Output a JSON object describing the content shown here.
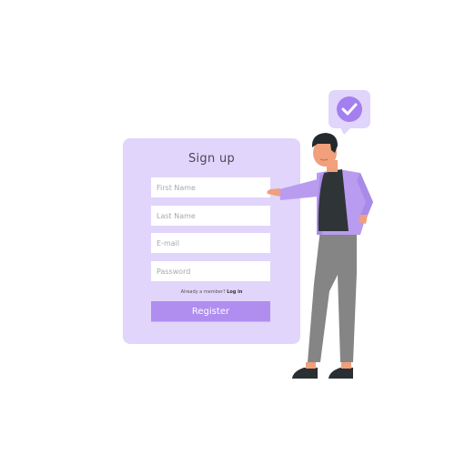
{
  "signup": {
    "title": "Sign up",
    "fields": {
      "first_name_placeholder": "First Name",
      "last_name_placeholder": "Last Name",
      "email_placeholder": "E-mail",
      "password_placeholder": "Password"
    },
    "login_prompt": "Already a member?",
    "login_link": "Log in",
    "register_label": "Register"
  },
  "illustration": {
    "badge_icon": "check-icon",
    "colors": {
      "accent": "#b08ef0",
      "card": "#e1d5fb",
      "jacket": "#b99cf0",
      "pants": "#858585",
      "shirt": "#2f3437"
    }
  }
}
